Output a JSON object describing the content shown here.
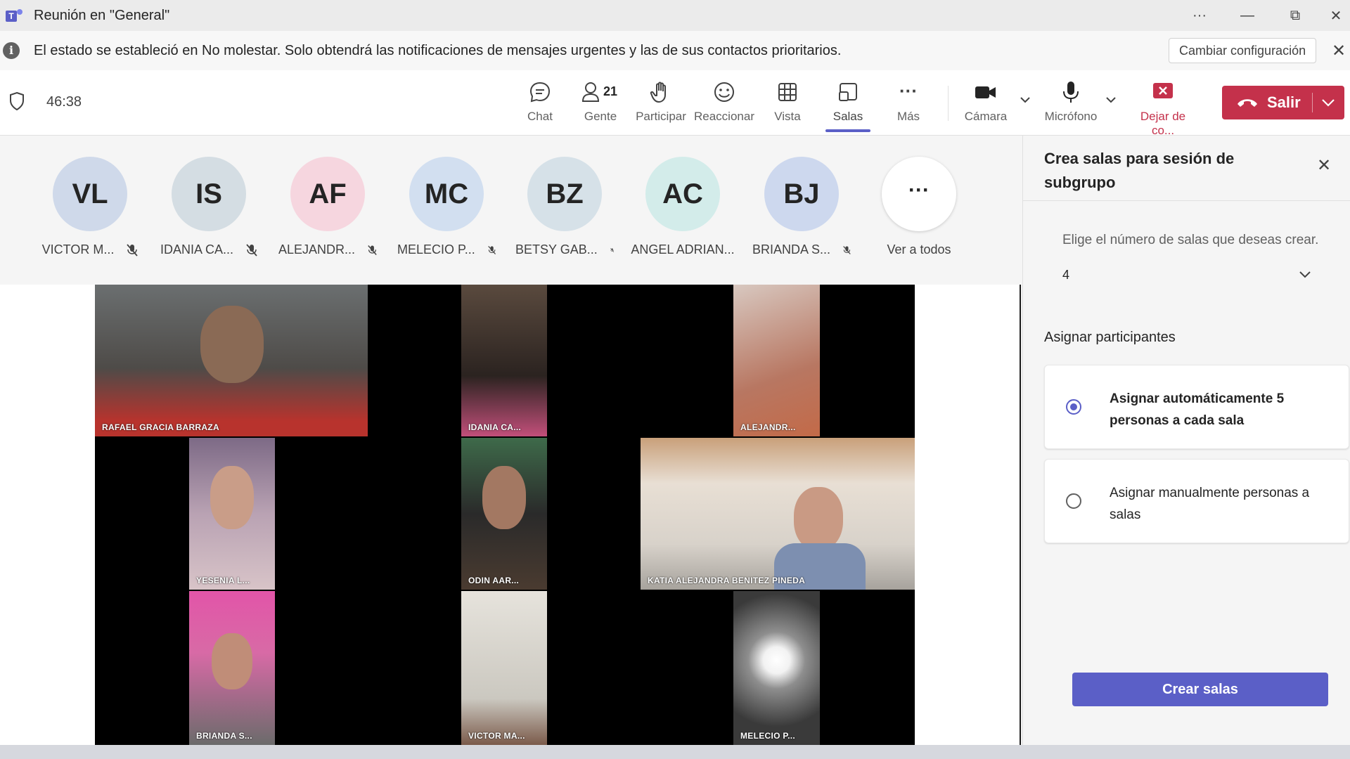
{
  "window": {
    "title": "Reunión en \"General\"",
    "more": "···",
    "minimize": "—",
    "restore": "⧉",
    "close": "✕"
  },
  "notification": {
    "text": "El estado se estableció en No molestar. Solo obtendrá las notificaciones de mensajes urgentes y las de sus contactos prioritarios.",
    "button": "Cambiar configuración",
    "close": "✕"
  },
  "toolbar": {
    "timer": "46:38",
    "chat": "Chat",
    "people": "Gente",
    "people_count": "21",
    "raise": "Participar",
    "react": "Reaccionar",
    "view": "Vista",
    "rooms": "Salas",
    "more": "Más",
    "more_dots": "···",
    "camera": "Cámara",
    "mic": "Micrófono",
    "share": "Dejar de co...",
    "leave": "Salir",
    "colors": {
      "accent": "#5b5fc7",
      "leave": "#c4314b"
    }
  },
  "participants": [
    {
      "initials": "VL",
      "name": "VICTOR M...",
      "bg": "#cfd9ea"
    },
    {
      "initials": "IS",
      "name": "IDANIA CA...",
      "bg": "#d4dde3"
    },
    {
      "initials": "AF",
      "name": "ALEJANDR...",
      "bg": "#f6d6df"
    },
    {
      "initials": "MC",
      "name": "MELECIO P...",
      "bg": "#d2dff0"
    },
    {
      "initials": "BZ",
      "name": "BETSY GAB...",
      "bg": "#d6e1e8"
    },
    {
      "initials": "AC",
      "name": "ANGEL ADRIAN...",
      "bg": "#d3ecea"
    },
    {
      "initials": "BJ",
      "name": "BRIANDA S...",
      "bg": "#cdd8ee"
    }
  ],
  "see_all": {
    "label": "Ver a todos",
    "dots": "···"
  },
  "videos": [
    "RAFAEL GRACIA BARRAZA",
    "IDANIA CA...",
    "ALEJANDR...",
    "YESENIA L...",
    "ODIN AAR...",
    "KATIA ALEJANDRA BENITEZ PINEDA",
    "BRIANDA S...",
    "VICTOR MA...",
    "MELECIO P..."
  ],
  "panel": {
    "title": "Crea salas para sesión de subgrupo",
    "close": "✕",
    "subtitle": "Elige el número de salas que deseas crear.",
    "rooms_value": "4",
    "assign_heading": "Asignar participantes",
    "option_auto": "Asignar automáticamente 5 personas a cada sala",
    "option_manual": "Asignar manualmente personas a salas",
    "create_button": "Crear salas"
  }
}
